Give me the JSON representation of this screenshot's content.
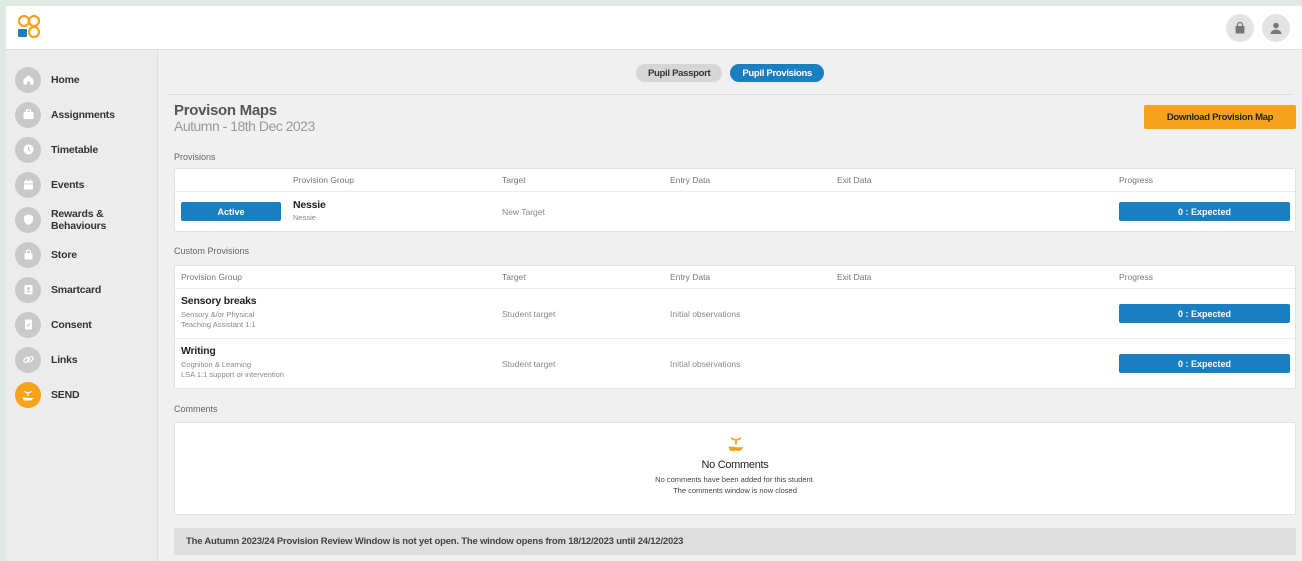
{
  "top_icons": [
    "bag-icon",
    "user-icon"
  ],
  "sidebar": {
    "items": [
      {
        "label": "Home",
        "icon": "home-icon"
      },
      {
        "label": "Assignments",
        "icon": "briefcase-icon"
      },
      {
        "label": "Timetable",
        "icon": "clock-icon"
      },
      {
        "label": "Events",
        "icon": "calendar-icon"
      },
      {
        "label": "Rewards & Behaviours",
        "icon": "shield-icon"
      },
      {
        "label": "Store",
        "icon": "bag-icon"
      },
      {
        "label": "Smartcard",
        "icon": "id-card-icon"
      },
      {
        "label": "Consent",
        "icon": "document-check-icon"
      },
      {
        "label": "Links",
        "icon": "link-icon"
      },
      {
        "label": "SEND",
        "icon": "hand-plant-icon",
        "active": true
      }
    ]
  },
  "tabs": [
    {
      "label": "Pupil Passport",
      "active": false
    },
    {
      "label": "Pupil Provisions",
      "active": true
    }
  ],
  "header": {
    "title": "Provison Maps",
    "subtitle": "Autumn - 18th Dec 2023",
    "download_label": "Download Provision Map"
  },
  "provisions": {
    "section_label": "Provisions",
    "columns": [
      "Provision Group",
      "Target",
      "Entry Data",
      "Exit Data",
      "Progress"
    ],
    "rows": [
      {
        "status": "Active",
        "title": "Nessie",
        "sub": "Nessie",
        "target": "New Target",
        "entry": "",
        "exit": "",
        "progress": "0 : Expected"
      }
    ]
  },
  "custom_provisions": {
    "section_label": "Custom Provisions",
    "columns": [
      "Provision Group",
      "Target",
      "Entry Data",
      "Exit Data",
      "Progress"
    ],
    "rows": [
      {
        "title": "Sensory breaks",
        "sub1": "Sensory &/or Physical",
        "sub2": "Teaching Assistant 1:1",
        "target": "Student target",
        "entry": "Initial observations",
        "exit": "",
        "progress": "0 : Expected"
      },
      {
        "title": "Writing",
        "sub1": "Cognition & Learning",
        "sub2": "LSA 1:1 support or intervention",
        "target": "Student target",
        "entry": "Initial observations",
        "exit": "",
        "progress": "0 : Expected"
      }
    ]
  },
  "comments": {
    "section_label": "Comments",
    "empty_title": "No Comments",
    "empty_line1": "No comments have been added for this student.",
    "empty_line2": "The comments window is now closed"
  },
  "notice": "The Autumn 2023/24 Provision Review Window is not yet open. The window opens from 18/12/2023 until 24/12/2023",
  "colors": {
    "accent": "#1a7fc1",
    "orange": "#f7a21b",
    "sidebar_bg": "#ececec",
    "main_bg": "#f0f0f0"
  }
}
